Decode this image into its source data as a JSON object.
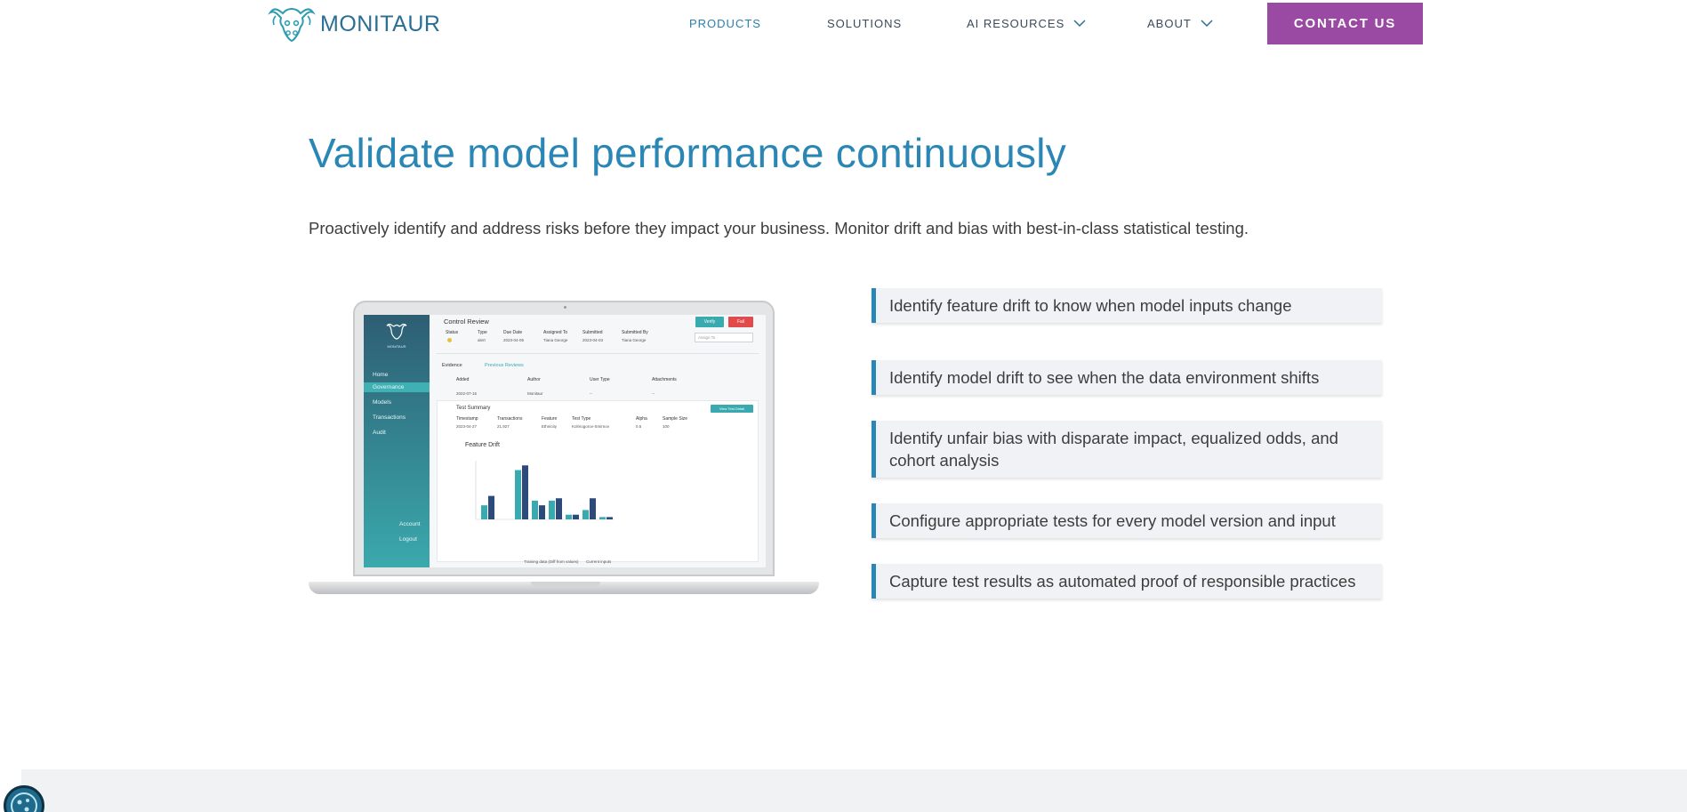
{
  "brand": {
    "name": "MONITAUR"
  },
  "nav": {
    "items": [
      {
        "label": "PRODUCTS",
        "active": true,
        "dropdown": false
      },
      {
        "label": "SOLUTIONS",
        "active": false,
        "dropdown": false
      },
      {
        "label": "AI RESOURCES",
        "active": false,
        "dropdown": true
      },
      {
        "label": "ABOUT",
        "active": false,
        "dropdown": true
      }
    ],
    "cta_label": "CONTACT US"
  },
  "hero": {
    "title": "Validate model performance continuously",
    "subtitle": "Proactively identify and address risks before they impact your business. Monitor drift and bias with best-in-class statistical testing."
  },
  "features": [
    "Identify feature drift to know when model inputs change",
    "Identify model drift to see when the data environment shifts",
    "Identify unfair bias with disparate impact, equalized odds, and cohort analysis",
    "Configure appropriate tests for every model version and input",
    "Capture test results as automated proof of responsible practices"
  ],
  "mockup": {
    "logo_text": "MONITAUR",
    "sidebar": [
      "Home",
      "Governance",
      "Models",
      "Transactions",
      "Audit"
    ],
    "sidebar_bottom": [
      "Account",
      "Logout"
    ],
    "page_title": "Control Review",
    "verify_label": "Verify",
    "fail_label": "Fail",
    "review_headers": [
      "Status",
      "Type",
      "Due Date",
      "Assigned To",
      "Submitted",
      "Submitted By"
    ],
    "review_values": [
      "",
      "alert",
      "2023-04-05",
      "Tiana George",
      "2023-04-03",
      "Tiana George"
    ],
    "assign_placeholder": "Assign To",
    "evidence_label": "Evidence",
    "previous_reviews_label": "Previous Reviews",
    "evidence_headers": [
      "Added",
      "Author",
      "User Type",
      "Attachments"
    ],
    "evidence_values": [
      "2022-07-15",
      "Monitaur",
      "--",
      "--"
    ],
    "test_summary_label": "Test Summary",
    "view_test_label": "View Test Detail",
    "test_headers": [
      "Timestamp",
      "Transactions",
      "Feature",
      "Test Type",
      "Alpha",
      "Sample Size"
    ],
    "test_values": [
      "2023-04-27",
      "21,927",
      "Ethnicity",
      "Kolmogorov-Smirnov",
      "0.5",
      "100"
    ],
    "chart_title": "Feature Drift",
    "chart_legend": [
      "Training data (Diff from values)",
      "Current inputs"
    ],
    "chart_colors": [
      "#39aab0",
      "#2d4a7c"
    ],
    "chart_bars": [
      [
        12,
        20
      ],
      [
        0,
        0
      ],
      [
        42,
        46
      ],
      [
        16,
        12
      ],
      [
        16,
        18
      ],
      [
        4,
        4
      ],
      [
        8,
        18
      ],
      [
        2,
        2
      ]
    ]
  },
  "colors": {
    "accent": "#2a86b4",
    "cta": "#9b4aa3",
    "feature_bg": "#f1f2f5"
  }
}
